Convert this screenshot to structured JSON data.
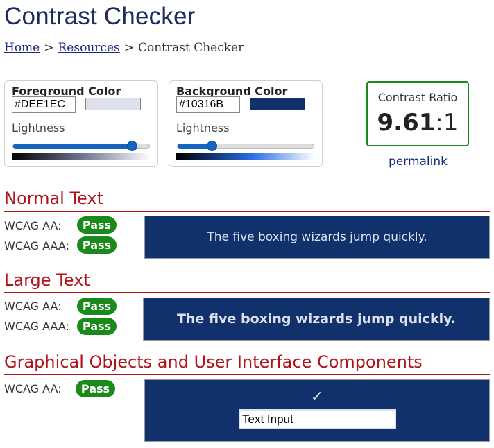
{
  "page": {
    "title": "Contrast Checker"
  },
  "breadcrumb": {
    "items": [
      "Home",
      "Resources"
    ],
    "current": "Contrast Checker",
    "separator": ">"
  },
  "foreground": {
    "title": "Foreground Color",
    "hex": "#DEE1EC",
    "swatch_color": "#dee1ec",
    "lightness_label": "Lightness",
    "lightness_fraction": 0.87
  },
  "background": {
    "title": "Background Color",
    "hex": "#10316B",
    "swatch_color": "#10316b",
    "lightness_label": "Lightness",
    "lightness_fraction": 0.25
  },
  "ratio": {
    "label": "Contrast Ratio",
    "value": "9.61",
    "suffix": ":1",
    "link": "permalink"
  },
  "sections": {
    "normal": {
      "heading": "Normal Text",
      "rows": [
        {
          "label": "WCAG AA:",
          "result": "Pass"
        },
        {
          "label": "WCAG AAA:",
          "result": "Pass"
        }
      ],
      "sample_text": "The five boxing wizards jump quickly."
    },
    "large": {
      "heading": "Large Text",
      "rows": [
        {
          "label": "WCAG AA:",
          "result": "Pass"
        },
        {
          "label": "WCAG AAA:",
          "result": "Pass"
        }
      ],
      "sample_text": "The five boxing wizards jump quickly."
    },
    "graphics": {
      "heading": "Graphical Objects and User Interface Components",
      "rows": [
        {
          "label": "WCAG AA:",
          "result": "Pass"
        }
      ],
      "check_glyph": "✓",
      "input_value": "Text Input"
    }
  },
  "colors": {
    "pass": "#1a8a1a",
    "heading": "#b0141a",
    "link": "#1f2a7a"
  }
}
